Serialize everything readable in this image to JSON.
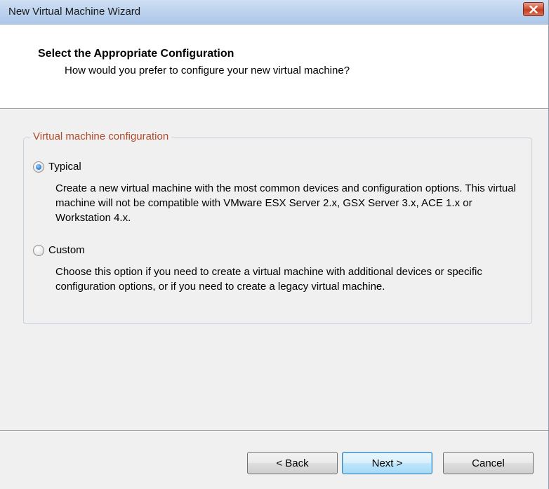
{
  "window": {
    "title": "New Virtual Machine Wizard"
  },
  "header": {
    "title": "Select the Appropriate Configuration",
    "subtitle": "How would you prefer to configure your new virtual machine?"
  },
  "config_group": {
    "legend": "Virtual machine configuration",
    "selected": "typical",
    "options": [
      {
        "id": "typical",
        "label": "Typical",
        "checked": true,
        "description": "Create a new virtual machine with the most common devices and configuration options. This virtual machine will not be compatible with VMware ESX Server 2.x, GSX Server 3.x, ACE 1.x or Workstation 4.x."
      },
      {
        "id": "custom",
        "label": "Custom",
        "checked": false,
        "description": "Choose this option if you need to create a virtual machine with additional devices or specific configuration options, or if you need to create a legacy virtual machine."
      }
    ]
  },
  "footer": {
    "back_label": "< Back",
    "next_label": "Next >",
    "cancel_label": "Cancel"
  },
  "icons": {
    "close": "close-icon"
  },
  "colors": {
    "legend_text": "#b34b2b",
    "close_button": "#c43d20"
  }
}
